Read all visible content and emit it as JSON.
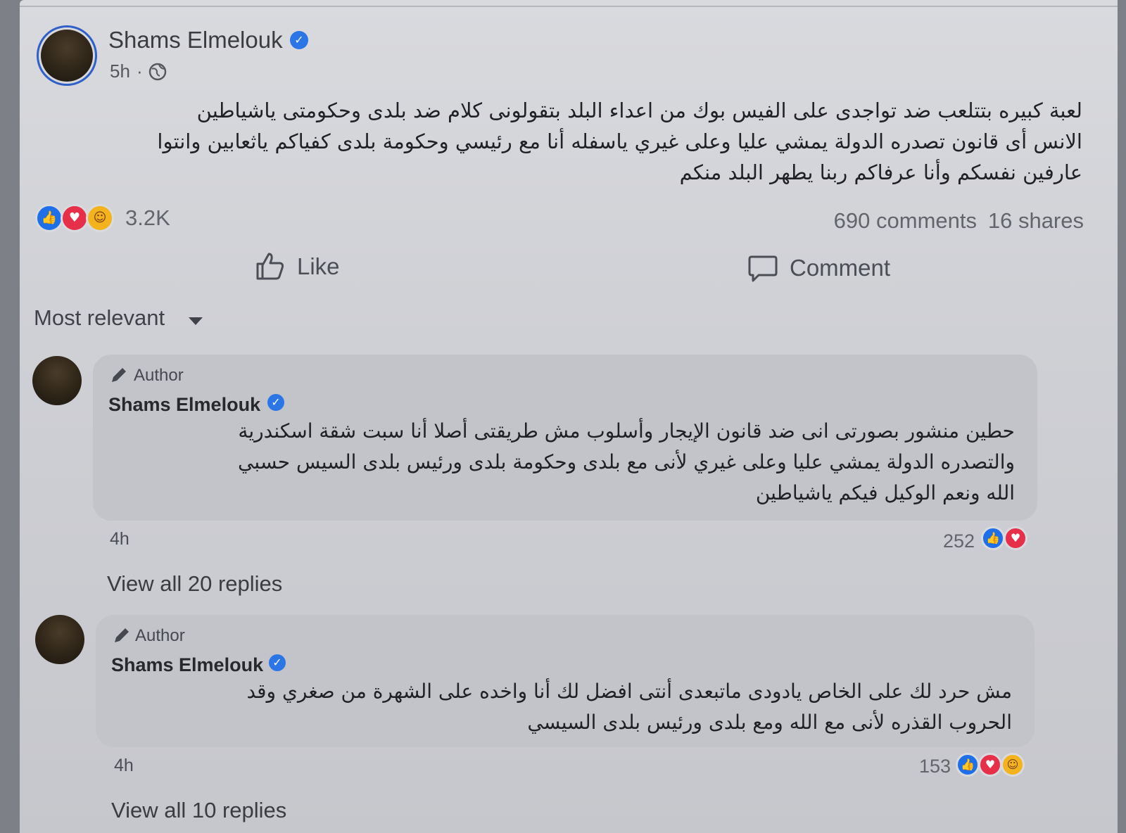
{
  "post": {
    "author": "Shams Elmelouk",
    "time": "5h",
    "separator": "·",
    "text_lines": [
      "لعبة كبيره بتتلعب ضد تواجدى على الفيس بوك من اعداء البلد بتقولونى كلام ضد بلدى وحكومتى ياشياطين",
      "الانس أى قانون تصدره الدولة يمشي عليا وعلى غيري ياسفله أنا مع رئيسي وحكومة بلدى كفياكم ياثعابين وانتوا",
      "عارفين نفسكم وأنا عرفاكم ربنا يطهر البلد منكم"
    ],
    "reaction_count": "3.2K",
    "comments": "690 comments",
    "shares": "16 shares"
  },
  "actions": {
    "like": "Like",
    "comment": "Comment"
  },
  "sort": {
    "label": "Most relevant"
  },
  "comments": [
    {
      "badge": "Author",
      "author": "Shams Elmelouk",
      "text_lines": [
        "حطين منشور بصورتى انى ضد قانون الإيجار وأسلوب مش طريقتى أصلا أنا سبت شقة اسكندرية",
        "والتصدره الدولة يمشي عليا وعلى غيري لأنى مع بلدى وحكومة بلدى ورئيس بلدى السيس حسبي",
        "الله ونعم الوكيل فيكم ياشياطين"
      ],
      "time": "4h",
      "reaction_count": "252",
      "replies": "View all 20 replies"
    },
    {
      "badge": "Author",
      "author": "Shams Elmelouk",
      "text_lines": [
        "مش حرد لك على الخاص يادودى ماتبعدى أنتى افضل لك أنا واخده على الشهرة من صغري وقد",
        "الحروب القذره لأنى مع الله ومع بلدى ورئيس بلدى السيسي"
      ],
      "time": "4h",
      "reaction_count": "153",
      "replies": "View all 10 replies"
    }
  ],
  "icons": {
    "verified": "verified-check-icon",
    "globe": "globe-icon",
    "like_reaction": "like-reaction-icon",
    "love_reaction": "love-reaction-icon",
    "care_reaction": "care-reaction-icon",
    "thumbs_up": "thumbs-up-icon",
    "comment": "comment-bubble-icon",
    "caret": "caret-down-icon",
    "pencil": "pencil-icon"
  },
  "colors": {
    "accent": "#2b75e6",
    "like": "#1f6fe8",
    "love": "#e6304a",
    "care": "#f2b31c"
  }
}
